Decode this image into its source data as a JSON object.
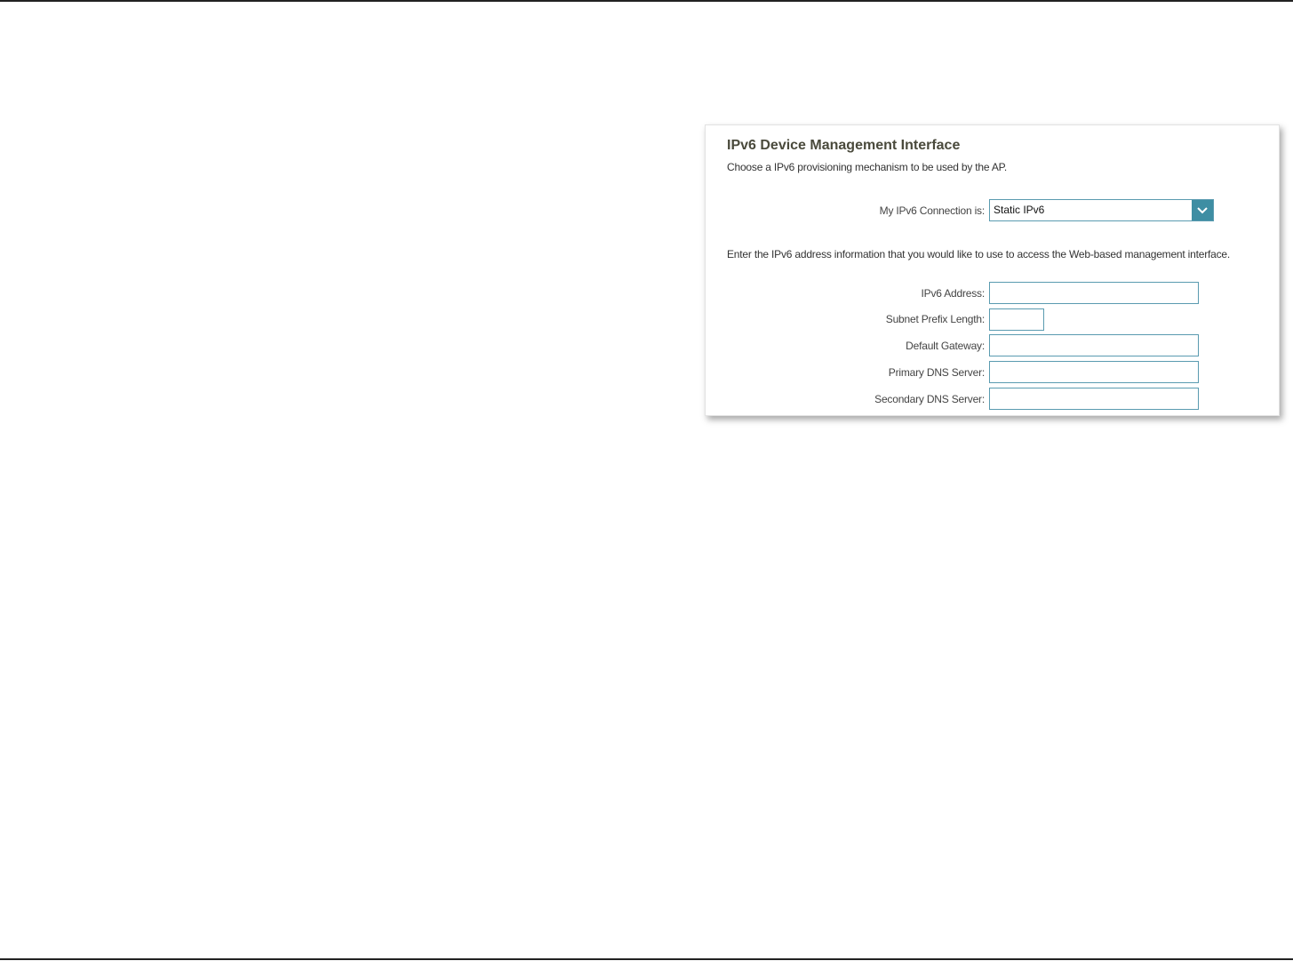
{
  "panel": {
    "title": "IPv6 Device Management Interface",
    "subtitle": "Choose a IPv6 provisioning mechanism to be used by the AP."
  },
  "connection": {
    "label": "My IPv6 Connection is:",
    "selected": "Static IPv6",
    "arrow_icon": "chevron-down-icon",
    "accent_color": "#3e8ea3"
  },
  "info_text": "Enter the IPv6 address information that you would like to use to access the Web-based management interface.",
  "fields": {
    "ipv6_address": {
      "label": "IPv6 Address:",
      "value": ""
    },
    "subnet_prefix_length": {
      "label": "Subnet Prefix Length:",
      "value": ""
    },
    "default_gateway": {
      "label": "Default Gateway:",
      "value": ""
    },
    "primary_dns": {
      "label": "Primary DNS Server:",
      "value": ""
    },
    "secondary_dns": {
      "label": "Secondary DNS Server:",
      "value": ""
    }
  }
}
